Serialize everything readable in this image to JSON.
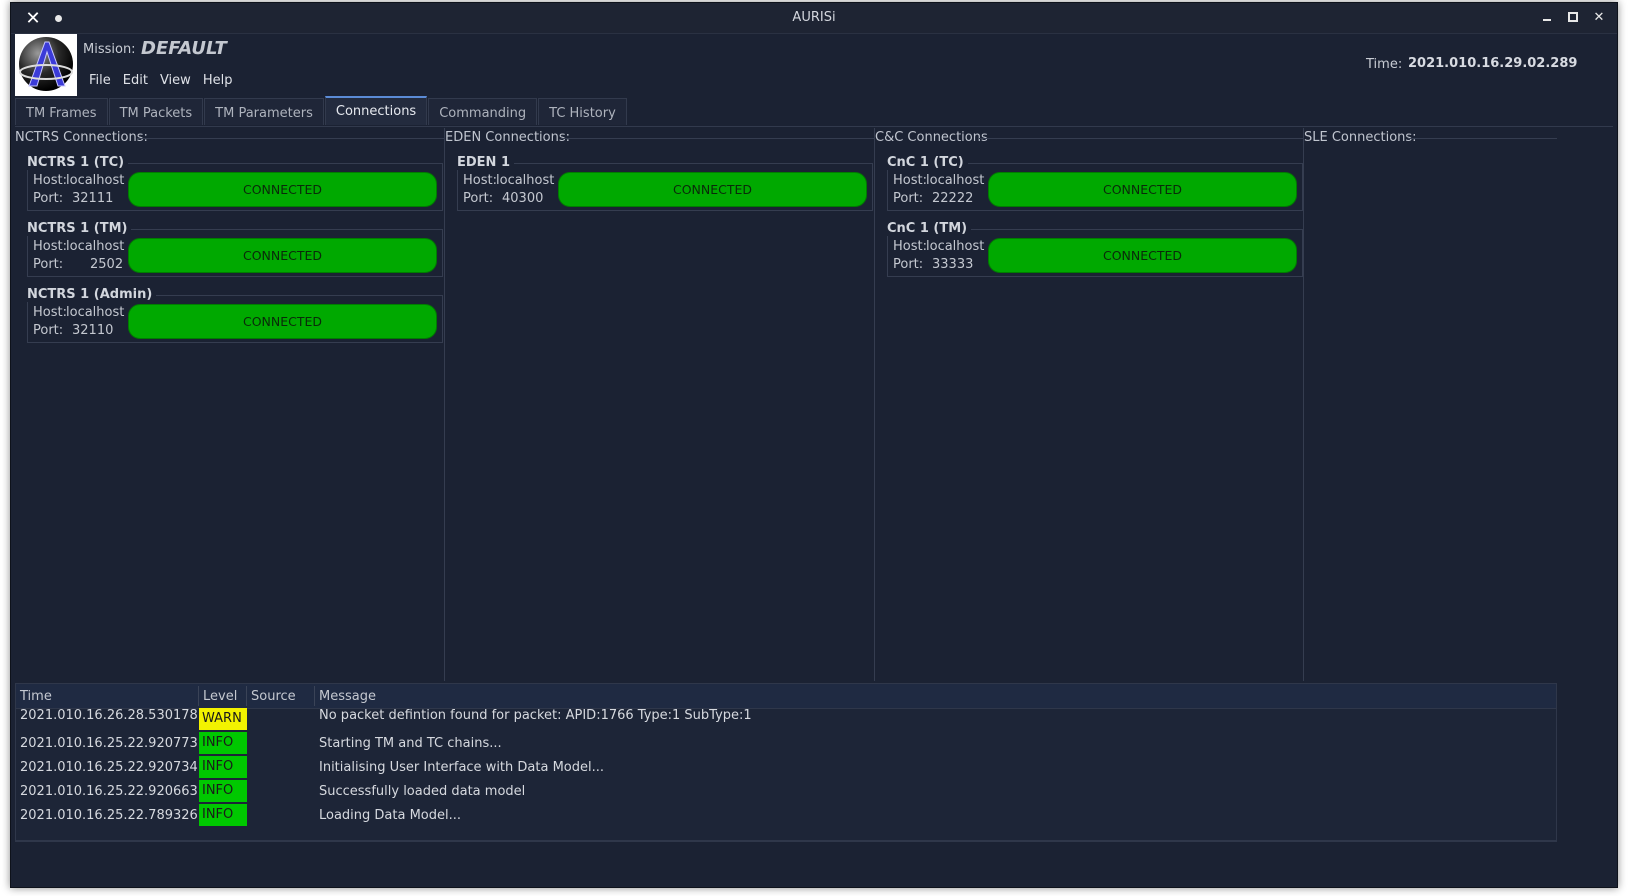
{
  "window": {
    "title": "AURISi"
  },
  "header": {
    "mission_label": "Mission:",
    "mission_value": "DEFAULT",
    "time_label": "Time:",
    "time_value": "2021.010.16.29.02.289"
  },
  "menu": [
    "File",
    "Edit",
    "View",
    "Help"
  ],
  "tabs": [
    {
      "label": "TM Frames",
      "active": false
    },
    {
      "label": "TM Packets",
      "active": false
    },
    {
      "label": "TM Parameters",
      "active": false
    },
    {
      "label": "Connections",
      "active": true
    },
    {
      "label": "Commanding",
      "active": false
    },
    {
      "label": "TC History",
      "active": false
    }
  ],
  "columns": [
    {
      "title": "NCTRS Connections:",
      "connections": [
        {
          "name": "NCTRS 1 (TC)",
          "host_label": "Host:",
          "host": "localhost",
          "port_label": "Port:",
          "port": "32111",
          "status": "CONNECTED"
        },
        {
          "name": "NCTRS 1 (TM)",
          "host_label": "Host:",
          "host": "localhost",
          "port_label": "Port:",
          "port": "2502",
          "status": "CONNECTED"
        },
        {
          "name": "NCTRS 1 (Admin)",
          "host_label": "Host:",
          "host": "localhost",
          "port_label": "Port:",
          "port": "32110",
          "status": "CONNECTED"
        }
      ]
    },
    {
      "title": "EDEN Connections:",
      "connections": [
        {
          "name": "EDEN 1",
          "host_label": "Host:",
          "host": "localhost",
          "port_label": "Port:",
          "port": "40300",
          "status": "CONNECTED"
        }
      ]
    },
    {
      "title": "C&C Connections",
      "connections": [
        {
          "name": "CnC 1 (TC)",
          "host_label": "Host:",
          "host": "localhost",
          "port_label": "Port:",
          "port": "22222",
          "status": "CONNECTED"
        },
        {
          "name": "CnC 1 (TM)",
          "host_label": "Host:",
          "host": "localhost",
          "port_label": "Port:",
          "port": "33333",
          "status": "CONNECTED"
        }
      ]
    },
    {
      "title": "SLE Connections:",
      "connections": []
    }
  ],
  "log": {
    "columns": [
      "Time",
      "Level",
      "Source",
      "Message"
    ],
    "rows": [
      {
        "time": "2021.010.16.26.28.530178",
        "level": "WARN",
        "source": "",
        "message": "No packet defintion found for packet: APID:1766 Type:1 SubType:1"
      },
      {
        "time": "2021.010.16.25.22.920773",
        "level": "INFO",
        "source": "",
        "message": "Starting TM and TC chains..."
      },
      {
        "time": "2021.010.16.25.22.920734",
        "level": "INFO",
        "source": "",
        "message": "Initialising User Interface with Data Model..."
      },
      {
        "time": "2021.010.16.25.22.920663",
        "level": "INFO",
        "source": "",
        "message": "Successfully loaded data model"
      },
      {
        "time": "2021.010.16.25.22.789326",
        "level": "INFO",
        "source": "",
        "message": "Loading Data Model..."
      }
    ]
  },
  "colors": {
    "connected": "#00a900",
    "warn": "#f2f200",
    "info": "#00c800",
    "background": "#1b2233"
  }
}
